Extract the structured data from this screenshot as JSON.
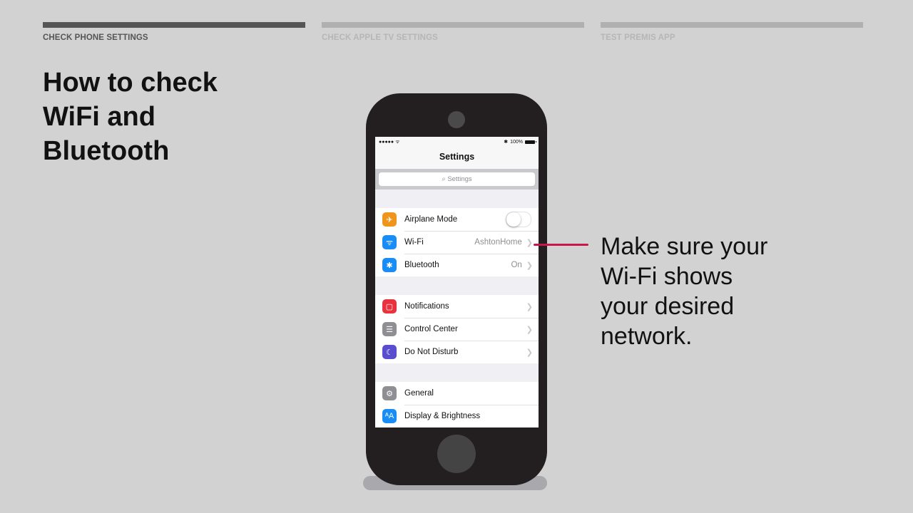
{
  "steps": [
    {
      "label": "CHECK PHONE SETTINGS",
      "active": true
    },
    {
      "label": "CHECK APPLE TV SETTINGS",
      "active": false
    },
    {
      "label": "TEST PREMIS APP",
      "active": false
    }
  ],
  "title": "How to check\nWiFi and\nBluetooth",
  "phone": {
    "statusbar": {
      "signal": "●●●●● ᯤ",
      "bluetooth": "✱",
      "battery": "100%"
    },
    "nav_title": "Settings",
    "search_placeholder": "Settings",
    "groups": [
      [
        {
          "label": "Airplane Mode",
          "icon": "airplane-icon",
          "color": "#f0951c",
          "type": "toggle",
          "toggle_on": false
        },
        {
          "label": "Wi-Fi",
          "icon": "wifi-icon",
          "color": "#1a8cf5",
          "value": "AshtonHome"
        },
        {
          "label": "Bluetooth",
          "icon": "bluetooth-icon",
          "color": "#1a8cf5",
          "value": "On"
        }
      ],
      [
        {
          "label": "Notifications",
          "icon": "notifications-icon",
          "color": "#e8323e"
        },
        {
          "label": "Control Center",
          "icon": "control-center-icon",
          "color": "#8e8e93"
        },
        {
          "label": "Do Not Disturb",
          "icon": "moon-icon",
          "color": "#5a4ecf"
        }
      ],
      [
        {
          "label": "General",
          "icon": "gear-icon",
          "color": "#8e8e93"
        },
        {
          "label": "Display & Brightness",
          "icon": "display-icon",
          "color": "#1a8cf5"
        }
      ]
    ]
  },
  "callout": {
    "text": "Make sure your\nWi-Fi shows\nyour desired\nnetwork.",
    "line_color": "#c8174a"
  }
}
